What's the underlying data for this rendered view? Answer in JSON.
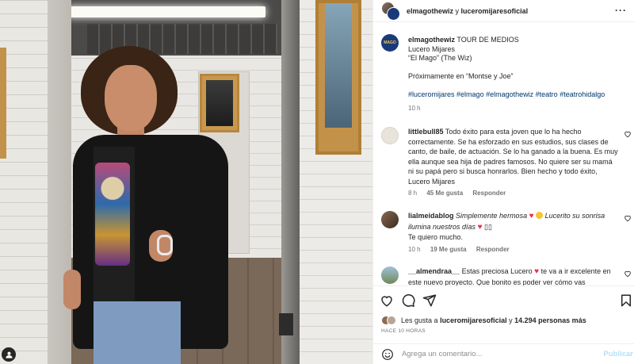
{
  "header": {
    "user1": "elmagothewiz",
    "joiner": "y",
    "user2": "luceromijaresoficial",
    "more_icon": "more-horizontal-icon"
  },
  "caption": {
    "avatar_text": "MAGO",
    "username": "elmagothewiz",
    "line1": "TOUR DE MEDIOS",
    "line2": "Lucero Mijares",
    "line3": "“El Mago” (The Wiz)",
    "line4": "Próximamente en “Montse y Joe”",
    "hashtags": [
      "#luceromijares",
      "#elmago",
      "#elmagothewiz",
      "#teatro",
      "#teatrohidalgo"
    ],
    "time": "10 h"
  },
  "comments": [
    {
      "username": "littlebull85",
      "text": "Todo éxito para esta joven que lo ha hecho correctamente. Se ha esforzado en sus estudios, sus clases de canto, de baile, de actuación. Se lo ha ganado a la buena. Es muy ella aunque sea hija de padres famosos. No quiere ser su mamá ni su papá pero si busca honrarlos. Bien hecho y todo éxito, Lucero Mijares",
      "time": "8 h",
      "likes": "45 Me gusta",
      "reply": "Responder"
    },
    {
      "username": "lialmeidablog",
      "text_a": "Simplemente hermosa",
      "text_b": "Lucerito su sonrisa ilumina nuestros días",
      "text_c": "Te quiero mucho.",
      "time": "10 h",
      "likes": "19 Me gusta",
      "reply": "Responder"
    },
    {
      "username": "__almendraa__",
      "text_a": "Estas preciosa Lucero",
      "text_b": "te va a ir excelente en este nuevo proyecto. Que bonito es poder ver cómo vas"
    }
  ],
  "likes": {
    "prefix": "Les gusta a",
    "user": "luceromijaresoficial",
    "joiner": "y",
    "count": "14.294 personas más"
  },
  "ago": "HACE 10 HORAS",
  "add_comment": {
    "placeholder": "Agrega un comentario...",
    "publish": "Publicar"
  },
  "colors": {
    "link": "#00376b",
    "muted": "#737373",
    "heart": "#ed2d4a",
    "publish_disabled": "#b2dffc"
  }
}
